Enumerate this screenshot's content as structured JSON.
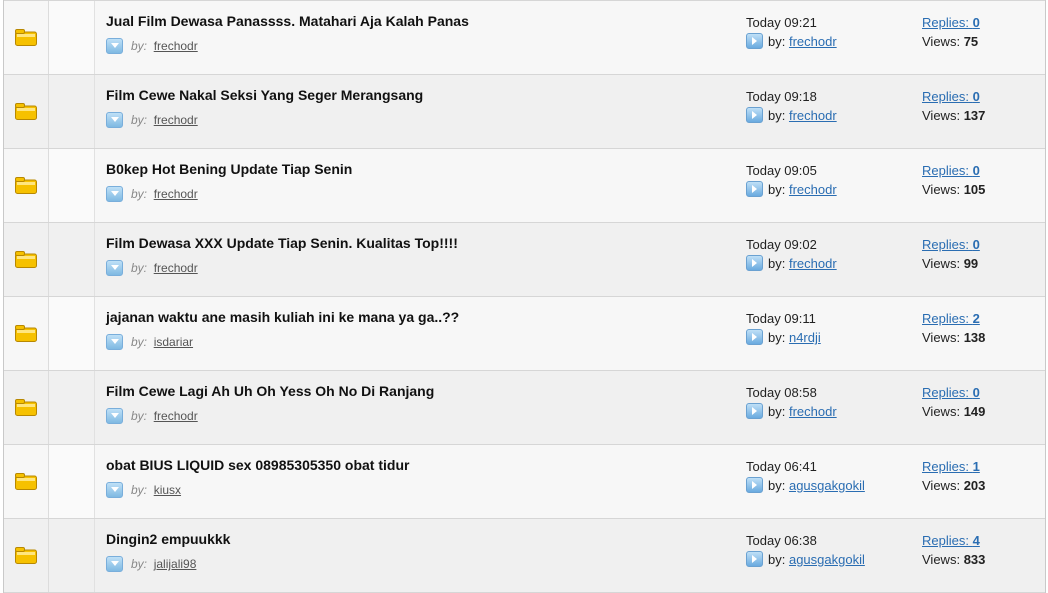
{
  "threads": [
    {
      "title": "Jual Film Dewasa Panassss. Matahari Aja Kalah Panas",
      "by_label": "by:",
      "author": "frechodr",
      "last_time": "Today 09:21",
      "last_by_label": "by:",
      "last_author": "frechodr",
      "replies_label": "Replies:",
      "replies": "0",
      "views_label": "Views:",
      "views": "75"
    },
    {
      "title": "Film Cewe Nakal Seksi Yang Seger Merangsang",
      "by_label": "by:",
      "author": "frechodr",
      "last_time": "Today 09:18",
      "last_by_label": "by:",
      "last_author": "frechodr",
      "replies_label": "Replies:",
      "replies": "0",
      "views_label": "Views:",
      "views": "137"
    },
    {
      "title": "B0kep Hot Bening Update Tiap Senin",
      "by_label": "by:",
      "author": "frechodr",
      "last_time": "Today 09:05",
      "last_by_label": "by:",
      "last_author": "frechodr",
      "replies_label": "Replies:",
      "replies": "0",
      "views_label": "Views:",
      "views": "105"
    },
    {
      "title": "Film Dewasa XXX Update Tiap Senin. Kualitas Top!!!!",
      "by_label": "by:",
      "author": "frechodr",
      "last_time": "Today 09:02",
      "last_by_label": "by:",
      "last_author": "frechodr",
      "replies_label": "Replies:",
      "replies": "0",
      "views_label": "Views:",
      "views": "99"
    },
    {
      "title": "jajanan waktu ane masih kuliah ini ke mana ya ga..??",
      "by_label": "by:",
      "author": "isdariar",
      "last_time": "Today 09:11",
      "last_by_label": "by:",
      "last_author": "n4rdji",
      "replies_label": "Replies:",
      "replies": "2",
      "views_label": "Views:",
      "views": "138"
    },
    {
      "title": "Film Cewe Lagi Ah Uh Oh Yess Oh No Di Ranjang",
      "by_label": "by:",
      "author": "frechodr",
      "last_time": "Today 08:58",
      "last_by_label": "by:",
      "last_author": "frechodr",
      "replies_label": "Replies:",
      "replies": "0",
      "views_label": "Views:",
      "views": "149"
    },
    {
      "title": "obat BIUS LIQUID sex 08985305350 obat tidur",
      "by_label": "by:",
      "author": "kiusx",
      "last_time": "Today 06:41",
      "last_by_label": "by:",
      "last_author": "agusgakgokil",
      "replies_label": "Replies:",
      "replies": "1",
      "views_label": "Views:",
      "views": "203"
    },
    {
      "title": "Dingin2 empuukkk",
      "by_label": "by:",
      "author": "jalijali98",
      "last_time": "Today 06:38",
      "last_by_label": "by:",
      "last_author": "agusgakgokil",
      "replies_label": "Replies:",
      "replies": "4",
      "views_label": "Views:",
      "views": "833"
    }
  ],
  "icons": {
    "thread_status": "folder-icon",
    "author_menu": "dropdown-arrow-icon",
    "last_post": "goto-last-post-icon"
  },
  "colors": {
    "link": "#2a6db2",
    "row_bg": "#f7f7f7",
    "row_alt_bg": "#f0f0f0",
    "folder": "#f5c400"
  }
}
